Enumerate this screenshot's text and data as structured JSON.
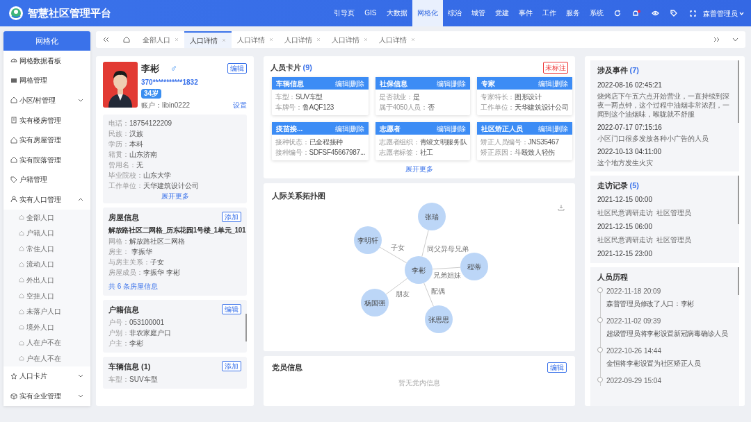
{
  "app": {
    "title": "智慧社区管理平台",
    "user": "森普管理员"
  },
  "nav": [
    {
      "label": "引导页",
      "selected": false
    },
    {
      "label": "GIS",
      "selected": false
    },
    {
      "label": "大数据",
      "selected": false
    },
    {
      "label": "网格化",
      "selected": true
    },
    {
      "label": "综治",
      "selected": false
    },
    {
      "label": "城管",
      "selected": false
    },
    {
      "label": "党建",
      "selected": false
    },
    {
      "label": "事件",
      "selected": false
    },
    {
      "label": "工作",
      "selected": false
    },
    {
      "label": "服务",
      "selected": false
    },
    {
      "label": "系统",
      "selected": false
    }
  ],
  "sidebar": {
    "title": "网格化",
    "items": [
      {
        "label": "网格数据看板"
      },
      {
        "label": "网格管理"
      },
      {
        "label": "小区/村管理",
        "expanded": false
      },
      {
        "label": "实有楼房管理"
      },
      {
        "label": "实有房屋管理"
      },
      {
        "label": "实有院落管理"
      },
      {
        "label": "户籍管理"
      },
      {
        "label": "实有人口管理",
        "expanded": true,
        "children": [
          {
            "label": "全部人口"
          },
          {
            "label": "户籍人口"
          },
          {
            "label": "常住人口"
          },
          {
            "label": "流动人口"
          },
          {
            "label": "外出人口"
          },
          {
            "label": "空挂人口"
          },
          {
            "label": "未落户人口"
          },
          {
            "label": "境外人口"
          },
          {
            "label": "人在户不在"
          },
          {
            "label": "户在人不在"
          }
        ]
      },
      {
        "label": "人口卡片",
        "expanded": false
      },
      {
        "label": "实有企业管理",
        "expanded": false
      }
    ]
  },
  "tabs": [
    {
      "label": "全部人口",
      "selected": false
    },
    {
      "label": "人口详情",
      "selected": true
    },
    {
      "label": "人口详情",
      "selected": false
    },
    {
      "label": "人口详情",
      "selected": false
    },
    {
      "label": "人口详情",
      "selected": false
    },
    {
      "label": "人口详情",
      "selected": false
    }
  ],
  "person": {
    "name": "李彬",
    "gender": "♂",
    "edit": "编辑",
    "id_number": "370***********1832",
    "age": "34岁",
    "account": "账户：libin0222",
    "settings": "设置",
    "details": [
      {
        "label": "电话：",
        "value": "18754122209"
      },
      {
        "label": "民族：",
        "value": "汉族"
      },
      {
        "label": "学历：",
        "value": "本科"
      },
      {
        "label": "籍贯：",
        "value": "山东济南"
      },
      {
        "label": "曾用名：",
        "value": "无"
      },
      {
        "label": "毕业院校：",
        "value": "山东大学"
      },
      {
        "label": "工作单位：",
        "value": "天华建筑设计公司"
      }
    ],
    "more": "展开更多"
  },
  "house": {
    "title": "房屋信息",
    "action": "添加",
    "address": "解放路社区二网格_历东花园1号楼_1单元_101",
    "details": [
      {
        "label": "网格：",
        "value": "解放路社区二网格"
      },
      {
        "label": "房主：",
        "value": " 李振华"
      },
      {
        "label": "与房主关系：",
        "value": "子女"
      },
      {
        "label": "房屋成员：",
        "value": "李振华 李彬"
      }
    ],
    "total": "共 6 条房屋信息"
  },
  "household": {
    "title": "户籍信息",
    "action": "编辑",
    "details": [
      {
        "label": "户号：",
        "value": "053100001"
      },
      {
        "label": "户别：",
        "value": "非农家庭户口"
      },
      {
        "label": "户主：",
        "value": "李彬"
      }
    ]
  },
  "vehicle": {
    "title": "车辆信息 (1)",
    "action": "添加",
    "details": [
      {
        "label": "车型：",
        "value": "SUV车型"
      }
    ]
  },
  "person_cards": {
    "title": "人员卡片",
    "count": "(9)",
    "tag": "未标注",
    "more": "展开更多",
    "cards": [
      {
        "title": "车辆信息",
        "actions": "编辑|删除",
        "fields": [
          {
            "label": "车型：",
            "value": "SUV车型"
          },
          {
            "label": "车牌号：",
            "value": "鲁AQF123"
          }
        ]
      },
      {
        "title": "社保信息",
        "actions": "编辑|删除",
        "fields": [
          {
            "label": "是否就业：",
            "value": "是"
          },
          {
            "label": "属于4050人员：",
            "value": "否"
          }
        ]
      },
      {
        "title": "专家",
        "actions": "编辑|删除",
        "fields": [
          {
            "label": "专家特长：",
            "value": "图形设计"
          },
          {
            "label": "工作单位：",
            "value": "天华建筑设计公司"
          }
        ]
      },
      {
        "title": "疫苗接...",
        "actions": "编辑|删除",
        "fields": [
          {
            "label": "接种状态：",
            "value": "已全程接种"
          },
          {
            "label": "接种编号：",
            "value": "SDFSF45667987..."
          }
        ]
      },
      {
        "title": "志愿者",
        "actions": "编辑|删除",
        "fields": [
          {
            "label": "志愿者组织：",
            "value": "青竣文明服务队"
          },
          {
            "label": "志愿者标签：",
            "value": "社工"
          }
        ]
      },
      {
        "title": "社区矫正人员",
        "actions": "编辑|删除",
        "fields": [
          {
            "label": "矫正人员编号：",
            "value": "JNS35467"
          },
          {
            "label": "矫正原因：",
            "value": "斗殴致人轻伤"
          }
        ]
      }
    ]
  },
  "relation_graph": {
    "title": "人际关系拓扑图",
    "center": "李彬",
    "relations": [
      {
        "name": "李明轩",
        "relation": "子女"
      },
      {
        "name": "张瑞",
        "relation": "同父异母兄弟"
      },
      {
        "name": "程蒂",
        "relation": "兄弟姐妹"
      },
      {
        "name": "杨国强",
        "relation": "朋友"
      },
      {
        "name": "张思思",
        "relation": "配偶"
      }
    ]
  },
  "party": {
    "title": "党员信息",
    "action": "编辑",
    "empty": "暂无党内信息"
  },
  "events": {
    "title": "涉及事件",
    "count": "(7)",
    "items": [
      {
        "time": "2022-08-16 02:45:21",
        "text": "烧烤店下午五六点开始营业，一直持续到深夜一两点钟，这个过程中油烟非常浓烈，一闻到这个油烟味，喉咙就不舒服"
      },
      {
        "time": "2022-07-17 07:15:16",
        "text": "小区门口很多发放各种小广告的人员"
      },
      {
        "time": "2022-10-13 04:11:00",
        "text": "这个地方发生火灾"
      }
    ]
  },
  "visits": {
    "title": "走访记录",
    "count": "(5)",
    "items": [
      {
        "time": "2021-12-15 00:00",
        "type": "社区民意调研走访",
        "by": "社区管理员"
      },
      {
        "time": "2021-12-15 06:00",
        "type": "社区民意调研走访",
        "by": "社区管理员"
      },
      {
        "time": "2021-12-15 23:00"
      }
    ]
  },
  "history": {
    "title": "人员历程",
    "items": [
      {
        "time": "2022-11-18 20:09",
        "text": "森普管理员修改了人口：李彬"
      },
      {
        "time": "2022-11-02 09:39",
        "text": "超级管理员将李彬设置新冠病毒确诊人员"
      },
      {
        "time": "2022-10-26 14:44",
        "text": "金恒将李彬设置为社区矫正人员"
      },
      {
        "time": "2022-09-29 15:04"
      }
    ]
  }
}
